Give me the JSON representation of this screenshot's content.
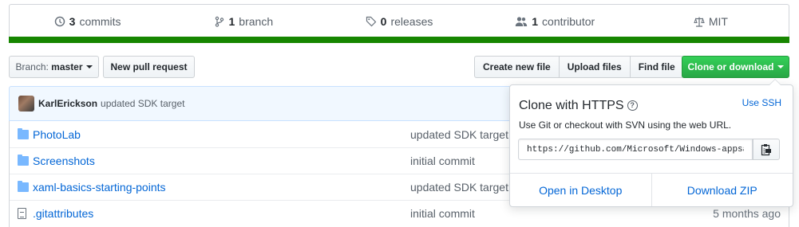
{
  "summary": {
    "commits_count": "3",
    "commits_label": "commits",
    "branches_count": "1",
    "branches_label": "branch",
    "releases_count": "0",
    "releases_label": "releases",
    "contributors_count": "1",
    "contributors_label": "contributor",
    "license": "MIT",
    "language_color": "#178600"
  },
  "toolbar": {
    "branch_prefix": "Branch:",
    "branch_name": "master",
    "new_pr_label": "New pull request",
    "create_file_label": "Create new file",
    "upload_files_label": "Upload files",
    "find_file_label": "Find file",
    "clone_label": "Clone or download"
  },
  "commit": {
    "author": "KarlErickson",
    "message": "updated SDK target"
  },
  "files": [
    {
      "type": "folder",
      "name": "PhotoLab",
      "commit": "updated SDK target",
      "age": ""
    },
    {
      "type": "folder",
      "name": "Screenshots",
      "commit": "initial commit",
      "age": ""
    },
    {
      "type": "folder",
      "name": "xaml-basics-starting-points",
      "commit": "updated SDK target",
      "age": ""
    },
    {
      "type": "file",
      "name": ".gitattributes",
      "commit": "initial commit",
      "age": "5 months ago"
    }
  ],
  "clone_popover": {
    "title": "Clone with HTTPS",
    "use_ssh": "Use SSH",
    "description": "Use Git or checkout with SVN using the web URL.",
    "url": "https://github.com/Microsoft/Windows-appsample-photo-lab.git",
    "open_desktop": "Open in Desktop",
    "download_zip": "Download ZIP"
  }
}
